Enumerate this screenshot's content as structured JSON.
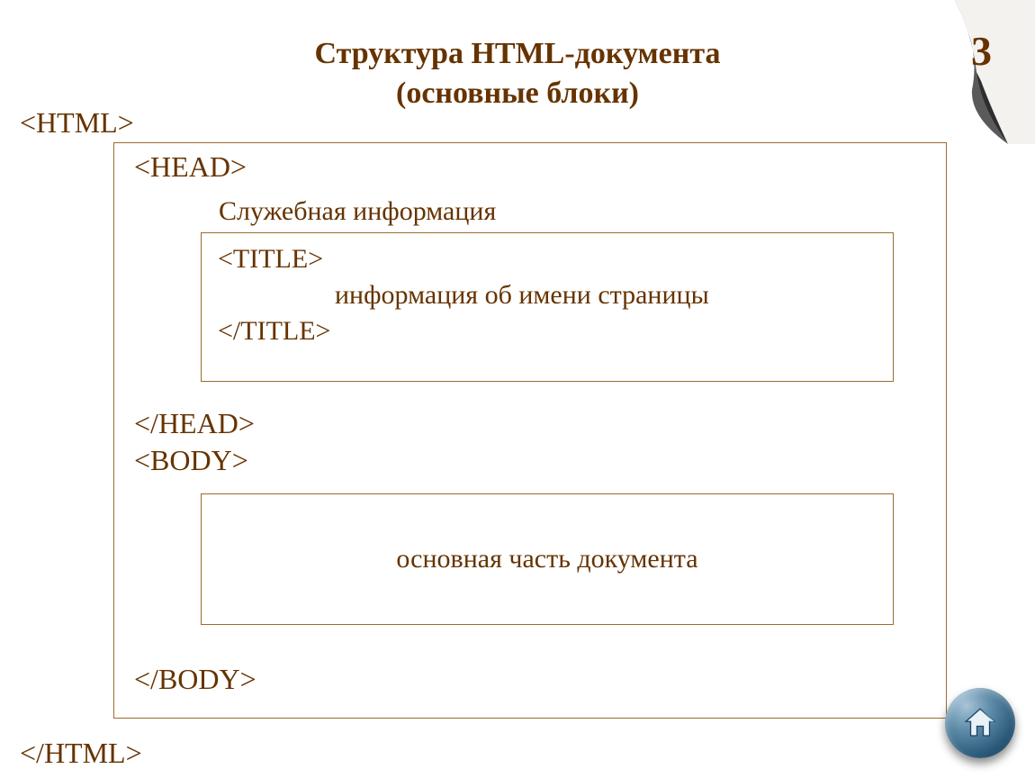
{
  "slide": {
    "number": "3",
    "title_line1": "Структура  HTML-документа",
    "title_line2": "(основные блоки)"
  },
  "tags": {
    "html_open": "<HTML>",
    "html_close": "</HTML>",
    "head_open": "<HEAD>",
    "head_close": "</HEAD>",
    "body_open": "<BODY>",
    "body_close": "</BODY>",
    "title_open": "<TITLE>",
    "title_close": "</TITLE>"
  },
  "labels": {
    "service_info": "Служебная  информация",
    "title_info": "информация об имени страницы",
    "body_content": "основная  часть документа"
  },
  "nav": {
    "home_icon": "home-icon"
  }
}
